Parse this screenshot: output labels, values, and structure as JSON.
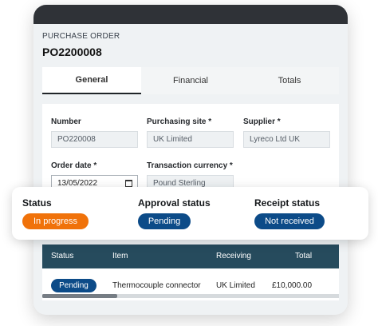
{
  "header": {
    "caption": "PURCHASE ORDER",
    "po_number": "PO2200008"
  },
  "tabs": [
    {
      "label": "General",
      "active": true
    },
    {
      "label": "Financial",
      "active": false
    },
    {
      "label": "Totals",
      "active": false
    }
  ],
  "form": {
    "number": {
      "label": "Number",
      "value": "PO220008"
    },
    "purchasing_site": {
      "label": "Purchasing site *",
      "value": "UK Limited"
    },
    "supplier": {
      "label": "Supplier *",
      "value": "Lyreco Ltd UK"
    },
    "order_date": {
      "label": "Order date *",
      "value": "13/05/2022",
      "icon": "calendar-icon"
    },
    "transaction_currency": {
      "label": "Transaction currency *",
      "value": "Pound Sterling"
    }
  },
  "statuses": {
    "status": {
      "label": "Status",
      "value": "In progress",
      "color": "#f0720a"
    },
    "approval": {
      "label": "Approval status",
      "value": "Pending",
      "color": "#0c4b88"
    },
    "receipt": {
      "label": "Receipt status",
      "value": "Not received",
      "color": "#0c4b88"
    }
  },
  "table": {
    "headers": [
      "Status",
      "Item",
      "Receiving",
      "Total"
    ],
    "rows": [
      {
        "status": "Pending",
        "item": "Thermocouple connector",
        "receiving": "UK Limited",
        "total": "£10,000.00"
      }
    ],
    "header_color": "#264b5d"
  }
}
